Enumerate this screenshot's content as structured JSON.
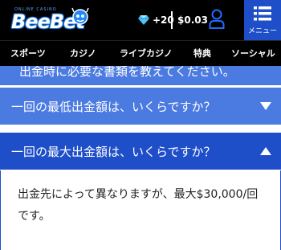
{
  "header": {
    "logo_text": "BeeBet",
    "logo_tagline": "ONLINE CASINO",
    "points": "+20",
    "balance": "$0.03",
    "menu_label": "メニュー"
  },
  "nav": {
    "items": [
      {
        "label": "スポーツ"
      },
      {
        "label": "カジノ"
      },
      {
        "label": "ライブカジノ"
      },
      {
        "label": "特典"
      },
      {
        "label": "ソーシャル"
      }
    ]
  },
  "faq": {
    "partial_question": "出金時に必要な書類を教えてください。",
    "items": [
      {
        "question": "一回の最低出金額は、いくらですか？",
        "expanded": false
      },
      {
        "question": "一回の最大出金額は、いくらですか？",
        "expanded": true,
        "answer": "出金先によって異なりますが、最大$30,000/回です。"
      }
    ]
  },
  "colors": {
    "header_bg": "#000000",
    "accent_blue": "#1e4fc9",
    "faq_blue": "#4b7ae0",
    "diamond": "#4fc3f7"
  }
}
